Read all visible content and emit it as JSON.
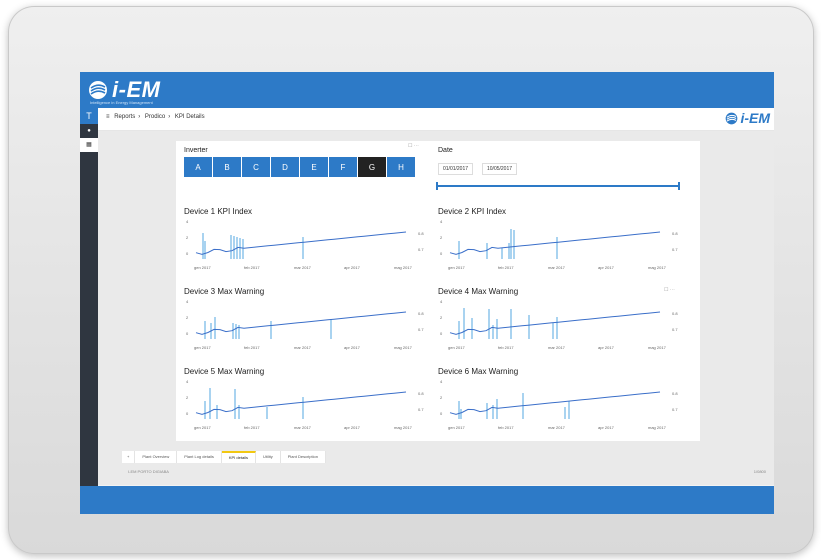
{
  "app": {
    "logo_text": "i-EM",
    "logo_subtitle": "Intelligence in Energy Management"
  },
  "leftnav": {
    "top_label": "T"
  },
  "breadcrumb": [
    "Reports",
    "Prodico",
    "KPI Details"
  ],
  "inverter": {
    "label": "Inverter",
    "options": [
      "A",
      "B",
      "C",
      "D",
      "E",
      "F",
      "G",
      "H"
    ],
    "selected": "G"
  },
  "date": {
    "label": "Date",
    "from": "01/01/2017",
    "to": "10/05/2017"
  },
  "charts": [
    {
      "title": "Device 1 KPI Index",
      "y_ticks": [
        "4",
        "2",
        "0"
      ],
      "y2_ticks": [
        "0.8",
        "0.7"
      ],
      "x_ticks": [
        "gen 2017",
        "feb 2017",
        "mar 2017",
        "apr 2017",
        "mag 2017"
      ]
    },
    {
      "title": "Device 2 KPI Index",
      "y_ticks": [
        "4",
        "2",
        "0"
      ],
      "y2_ticks": [
        "0.8",
        "0.7"
      ],
      "x_ticks": [
        "gen 2017",
        "feb 2017",
        "mar 2017",
        "apr 2017",
        "mag 2017"
      ]
    },
    {
      "title": "Device 3 Max Warning",
      "y_ticks": [
        "4",
        "2",
        "0"
      ],
      "y2_ticks": [
        "0.8",
        "0.7"
      ],
      "x_ticks": [
        "gen 2017",
        "feb 2017",
        "mar 2017",
        "apr 2017",
        "mag 2017"
      ]
    },
    {
      "title": "Device 4 Max Warning",
      "y_ticks": [
        "4",
        "2",
        "0"
      ],
      "y2_ticks": [
        "0.8",
        "0.7"
      ],
      "x_ticks": [
        "gen 2017",
        "feb 2017",
        "mar 2017",
        "apr 2017",
        "mag 2017"
      ]
    },
    {
      "title": "Device 5 Max Warning",
      "y_ticks": [
        "4",
        "2",
        "0"
      ],
      "y2_ticks": [
        "0.8",
        "0.7"
      ],
      "x_ticks": [
        "gen 2017",
        "feb 2017",
        "mar 2017",
        "apr 2017",
        "mag 2017"
      ]
    },
    {
      "title": "Device 6 Max Warning",
      "y_ticks": [
        "4",
        "2",
        "0"
      ],
      "y2_ticks": [
        "0.8",
        "0.7"
      ],
      "x_ticks": [
        "gen 2017",
        "feb 2017",
        "mar 2017",
        "apr 2017",
        "mag 2017"
      ]
    }
  ],
  "tabs": [
    "Plant Overview",
    "Plant Log details",
    "KPI details",
    "Utility",
    "Plant Description"
  ],
  "active_tab": "KPI details",
  "footer": {
    "left": "I-EM PORTO DIGIABA",
    "right": "1/0800"
  },
  "colors": {
    "brand": "#2d7ac7",
    "bar": "#a9d3f0",
    "line": "#3b6fc9",
    "selected": "#222222"
  }
}
